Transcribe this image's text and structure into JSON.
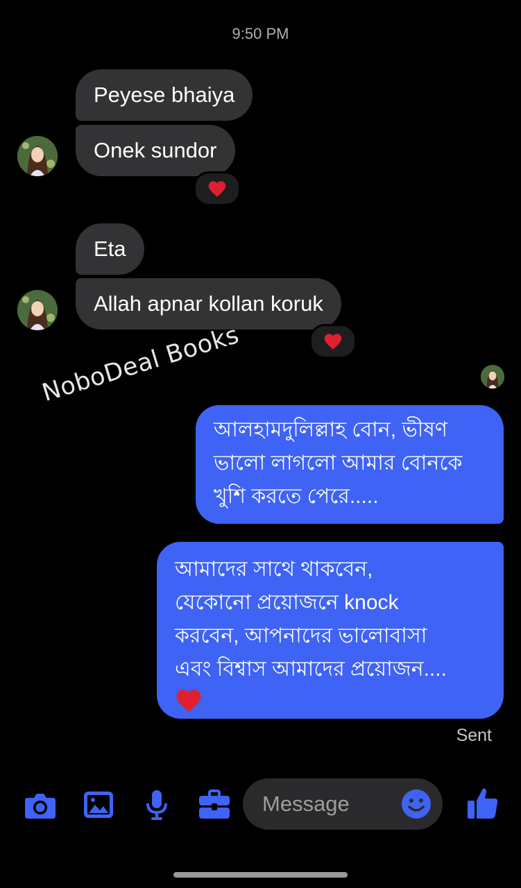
{
  "conversation": {
    "timestamp": "9:50 PM",
    "incoming": [
      {
        "text": "Peyese bhaiya"
      },
      {
        "text": "Onek sundor",
        "reaction": "heart-icon"
      },
      {
        "text": "Eta"
      },
      {
        "text": "Allah apnar kollan koruk",
        "reaction": "heart-icon"
      }
    ],
    "watermark": "NoboDeal Books",
    "outgoing": [
      {
        "lines": [
          "আলহামদুলিল্লাহ বোন, ভীষণ",
          "ভালো লাগলো আমার বোনকে",
          "খুশি করতে পেরে....."
        ]
      },
      {
        "lines": [
          "আমাদের সাথে থাকবেন,",
          "যেকোনো প্রয়োজনে knock",
          "করবেন, আপনাদের ভালোবাসা",
          "এবং বিশ্বাস আমাদের প্রয়োজন...."
        ],
        "trailing_emoji": "heart-icon"
      }
    ],
    "status": "Sent"
  },
  "composer": {
    "placeholder": "Message",
    "icons": [
      "camera-icon",
      "gallery-icon",
      "microphone-icon",
      "briefcase-icon",
      "emoji-icon",
      "thumbs-up-icon"
    ]
  },
  "colors": {
    "accent": "#3e63f5",
    "incoming_bubble": "#333335",
    "background": "#000000",
    "heart": "#e0202e"
  }
}
